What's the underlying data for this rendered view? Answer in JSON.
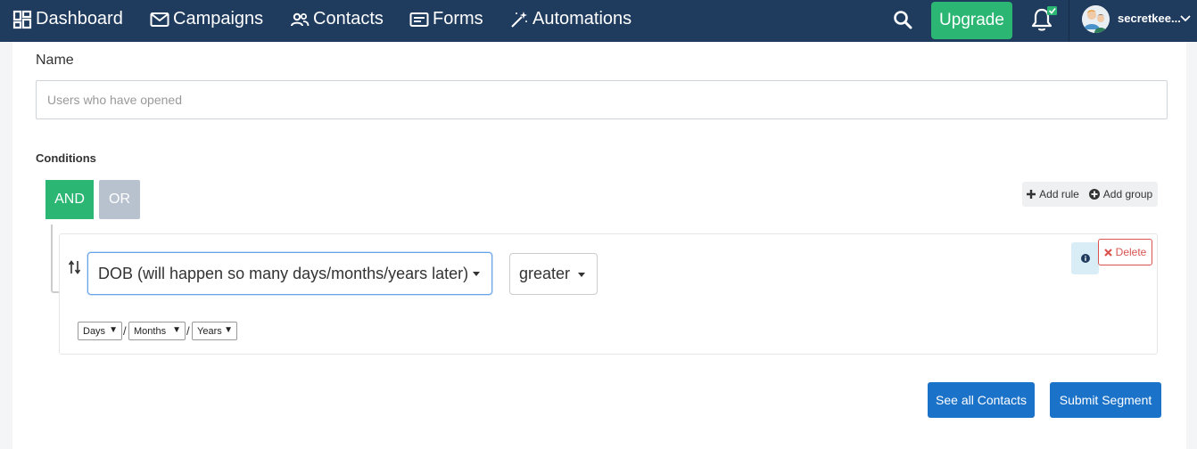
{
  "nav": {
    "items": [
      {
        "label": "Dashboard",
        "icon": "dashboard-icon"
      },
      {
        "label": "Campaigns",
        "icon": "envelope-icon"
      },
      {
        "label": "Contacts",
        "icon": "users-icon"
      },
      {
        "label": "Forms",
        "icon": "form-icon"
      },
      {
        "label": "Automations",
        "icon": "magic-wand-icon"
      }
    ],
    "upgrade_label": "Upgrade",
    "username": "secretkee...",
    "colors": {
      "navbar": "#1f3b5e",
      "upgrade": "#2bb673",
      "notification_badge": "#2bb673"
    }
  },
  "form": {
    "name_label": "Name",
    "name_placeholder": "Users who have opened",
    "conditions_label": "Conditions"
  },
  "builder": {
    "and_label": "AND",
    "or_label": "OR",
    "add_rule_label": "Add rule",
    "add_group_label": "Add group",
    "rule": {
      "field_value": "DOB (will happen so many days/months/years later)",
      "operator_value": "greater",
      "delete_label": "Delete",
      "unit_selects": [
        "Days",
        "Months",
        "Years"
      ],
      "separator": "/"
    }
  },
  "actions": {
    "see_contacts_label": "See all Contacts",
    "submit_label": "Submit Segment"
  }
}
